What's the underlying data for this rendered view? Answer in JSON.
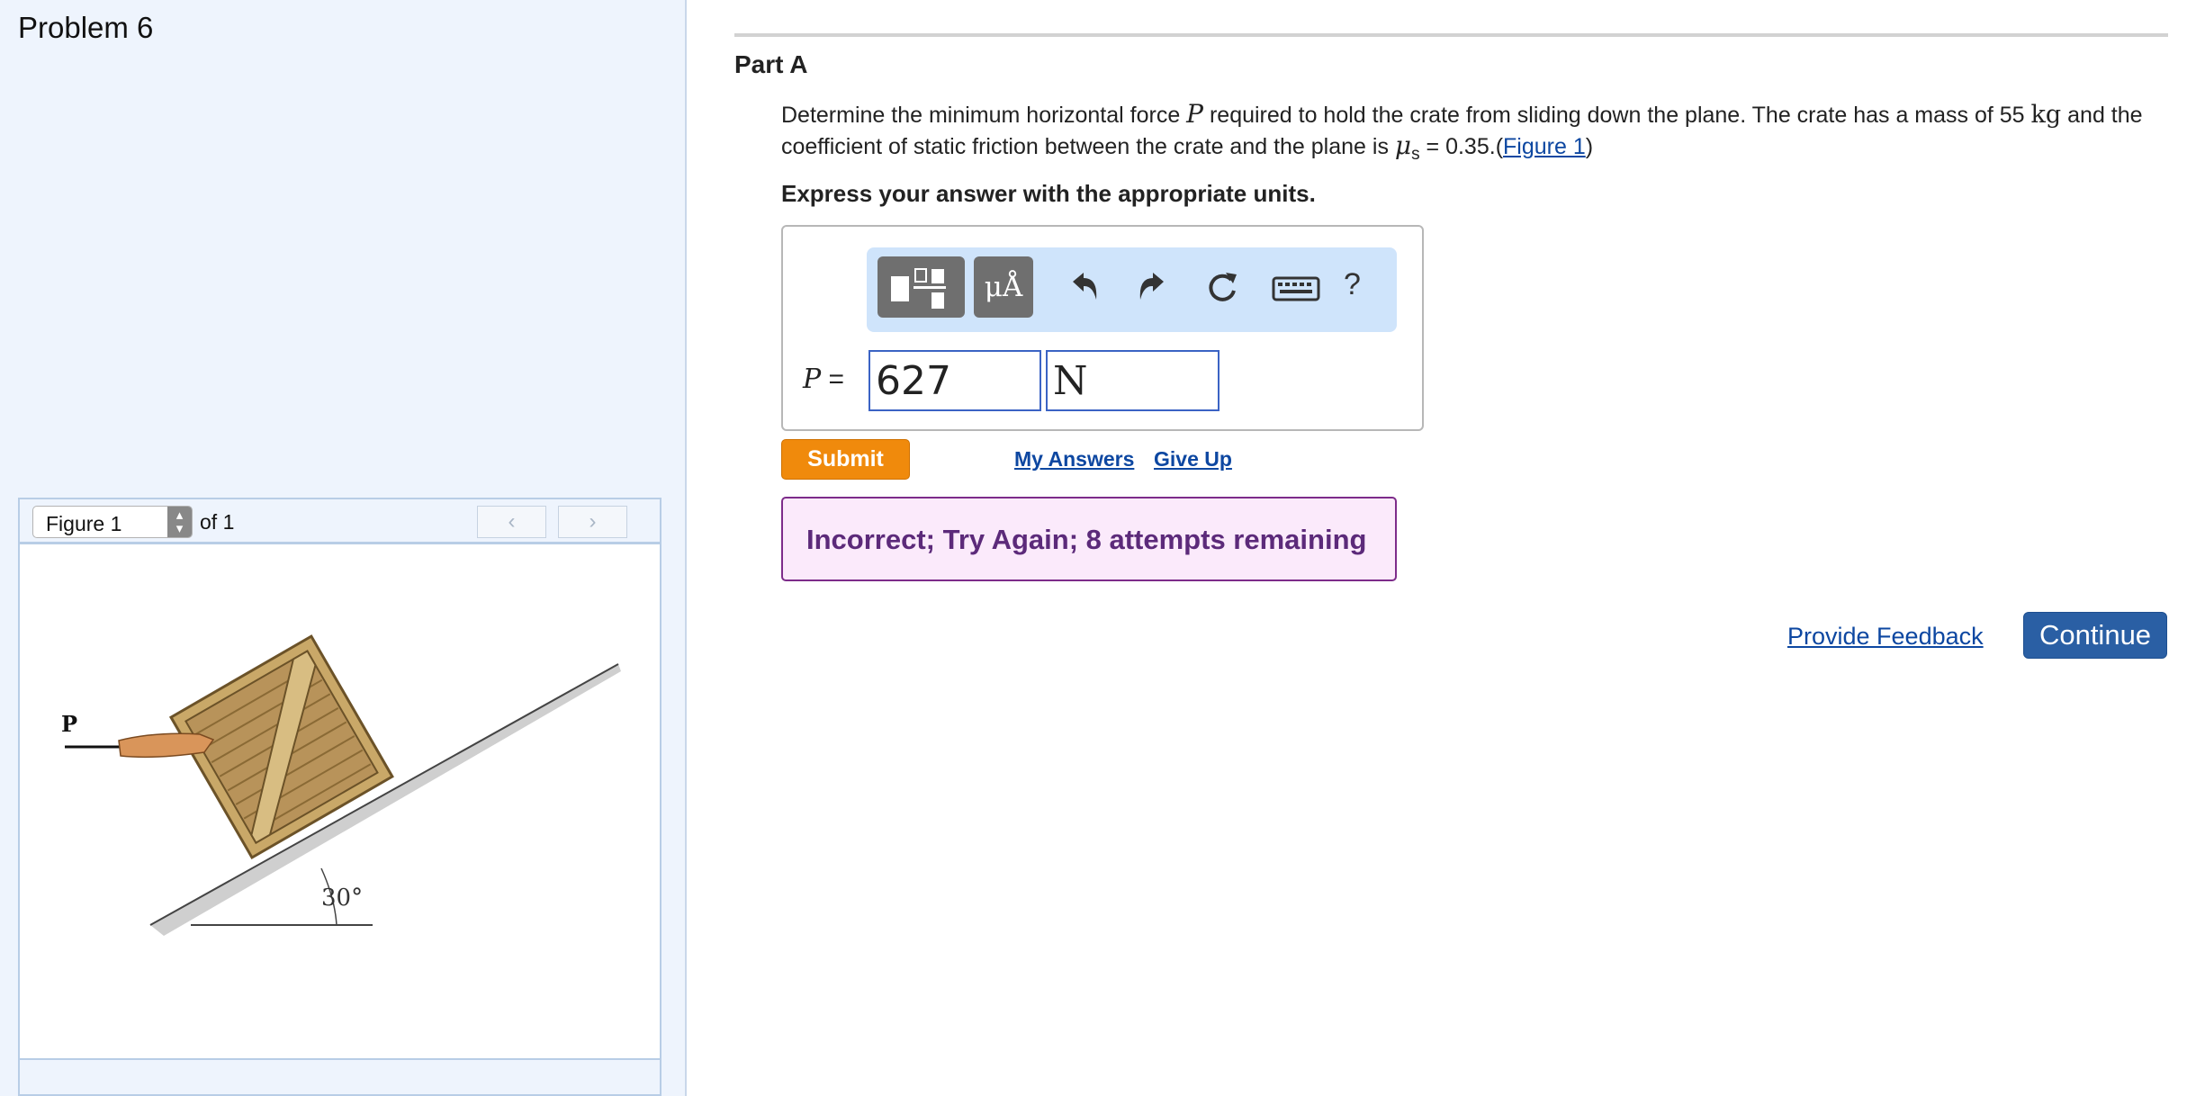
{
  "problem": {
    "title": "Problem 6"
  },
  "figure_panel": {
    "select_value": "Figure 1",
    "of_text": "of 1",
    "prev_icon": "chevron-left-icon",
    "next_icon": "chevron-right-icon",
    "figure_labels": {
      "force": "P",
      "angle": "30°"
    }
  },
  "part": {
    "title": "Part A",
    "question": {
      "text_1": "Determine the minimum horizontal force ",
      "force_symbol": "P",
      "text_2": " required to hold the crate from sliding down the plane. The crate has a mass of 55 ",
      "mass_unit": "kg",
      "text_3": " and the coefficient of static friction between the crate and the plane is ",
      "mu_symbol": "μ",
      "mu_subscript": "s",
      "text_4": " = 0.35.(",
      "figure_link": "Figure 1",
      "text_5": ")"
    },
    "instruction": "Express your answer with the appropriate units."
  },
  "answer": {
    "toolbar": {
      "templates_icon": "templates-icon",
      "units_label": "μÅ",
      "undo_icon": "undo-icon",
      "redo_icon": "redo-icon",
      "reset_icon": "reset-icon",
      "keyboard_icon": "keyboard-icon",
      "help_label": "?"
    },
    "variable": "P",
    "equals": "=",
    "value": "627",
    "unit": "N"
  },
  "actions": {
    "submit_label": "Submit",
    "my_answers_label": "My Answers",
    "give_up_label": "Give Up"
  },
  "feedback": {
    "message": "Incorrect; Try Again; 8 attempts remaining"
  },
  "footer": {
    "provide_feedback_label": "Provide Feedback",
    "continue_label": "Continue"
  },
  "colors": {
    "submit": "#f08a0c",
    "continue": "#2a5fa4",
    "feedback_border": "#7d2c8a",
    "feedback_bg": "#fbeafb",
    "input_border": "#3b63c4",
    "link": "#0d47a1",
    "left_panel_bg": "#eef4fd"
  }
}
